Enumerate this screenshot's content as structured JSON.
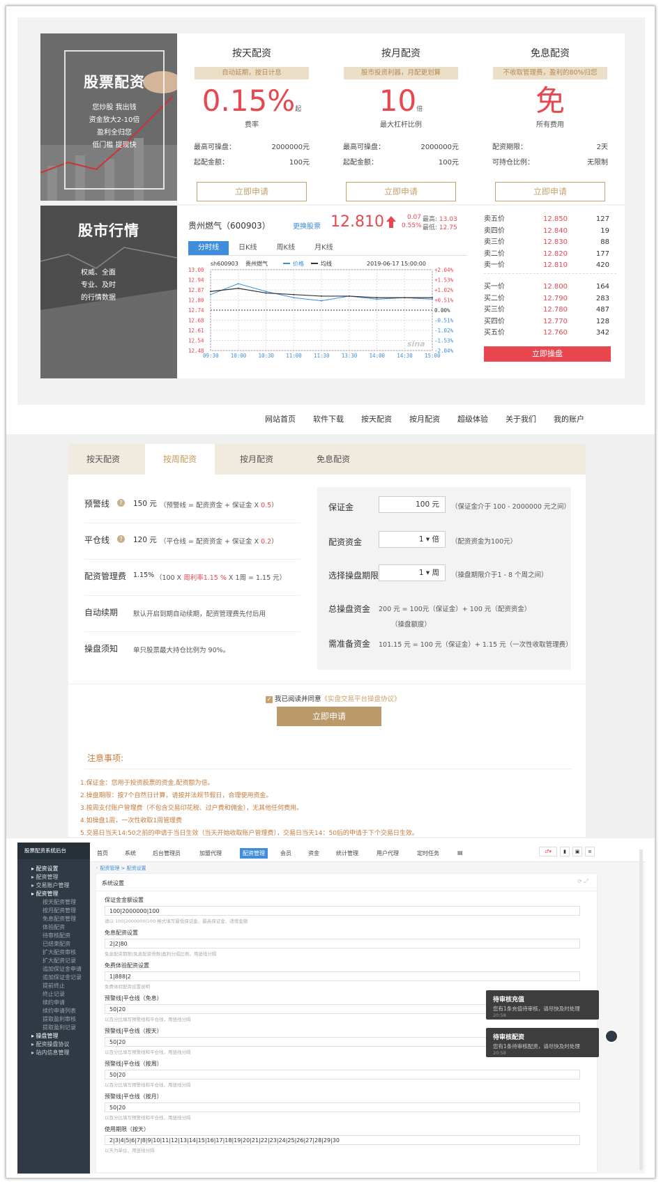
{
  "promo1": {
    "title": "股票配资",
    "lines": [
      "您炒股 我出钱",
      "资金放大2-10倍",
      "盈利全归您",
      "低门槛 提现快"
    ]
  },
  "promo2": {
    "title": "股市行情",
    "lines": [
      "权威、全面",
      "专业、及时",
      "的行情数据"
    ]
  },
  "cards": [
    {
      "title": "按天配资",
      "tag": "自动延期，按日计息",
      "big": "0.15%",
      "unit": "起",
      "sub": "费率",
      "rows": [
        [
          "最高可操盘：",
          "2000000元"
        ],
        [
          "起配金额：",
          "100元"
        ]
      ],
      "button": "立即申请"
    },
    {
      "title": "按月配资",
      "tag": "股市投资利器，月配更划算",
      "big": "10",
      "unit": "倍",
      "sub": "最大杠杆比例",
      "rows": [
        [
          "最高可操盘：",
          "2000000元"
        ],
        [
          "起配金额：",
          "100元"
        ]
      ],
      "button": "立即申请"
    },
    {
      "title": "免息配资",
      "tag": "不收取管理费，盈利的80%归您",
      "big": "免",
      "unit": "",
      "sub": "所有费用",
      "rows": [
        [
          "配资期限：",
          "2天"
        ],
        [
          "可持仓比例：",
          "无限制"
        ]
      ],
      "button": "立即申请"
    }
  ],
  "quote": {
    "name": "贵州燃气（600903）",
    "change_stock": "更换股票",
    "price": "12.810",
    "diff": "0.07",
    "pct": "0.55%",
    "high_label": "最高:",
    "high": "13.03",
    "low_label": "最低:",
    "low": "12.75",
    "tabs": [
      "分时线",
      "日K线",
      "周K线",
      "月K线"
    ],
    "chart_header": [
      "sh600903",
      "贵州燃气",
      "价格",
      "均线",
      "2019-06-17 15:00:00"
    ],
    "chart_title": "贵州燃气 分时线",
    "y_left": [
      "13.00",
      "12.94",
      "12.87",
      "12.80",
      "12.74",
      "12.68",
      "12.61",
      "12.54",
      "12.48"
    ],
    "y_right": [
      "+2.04%",
      "+1.53%",
      "+1.02%",
      "+0.51%",
      "0.00%",
      "-0.51%",
      "-1.02%",
      "-1.53%",
      "-2.04%"
    ],
    "x": [
      "09:30",
      "10:00",
      "10:30",
      "11:00",
      "11:30",
      "13:30",
      "14:00",
      "14:30",
      "15:00"
    ],
    "watermark": "sina",
    "sell": [
      [
        "卖五价",
        "12.850",
        "127"
      ],
      [
        "卖四价",
        "12.840",
        "19"
      ],
      [
        "卖三价",
        "12.830",
        "88"
      ],
      [
        "卖二价",
        "12.820",
        "177"
      ],
      [
        "卖一价",
        "12.810",
        "420"
      ]
    ],
    "buy": [
      [
        "买一价",
        "12.800",
        "164"
      ],
      [
        "买二价",
        "12.790",
        "283"
      ],
      [
        "买三价",
        "12.780",
        "487"
      ],
      [
        "买四价",
        "12.770",
        "128"
      ],
      [
        "买五价",
        "12.760",
        "342"
      ]
    ],
    "trade_button": "立即操盘",
    "colors": {
      "up": "#e8474f",
      "price_line": "#3f8ddb",
      "avg_line": "#333333",
      "tab_active": "#3f8ddb"
    }
  },
  "chart_data": {
    "type": "line",
    "x": [
      "09:30",
      "10:00",
      "10:30",
      "11:00",
      "11:30",
      "13:30",
      "14:00",
      "14:30",
      "15:00"
    ],
    "ylim": [
      12.48,
      13.0
    ],
    "series": [
      {
        "name": "价格",
        "values": [
          12.84,
          12.91,
          12.86,
          12.82,
          12.8,
          12.83,
          12.81,
          12.82,
          12.81
        ]
      },
      {
        "name": "均线",
        "values": [
          12.86,
          12.88,
          12.85,
          12.84,
          12.83,
          12.83,
          12.82,
          12.82,
          12.82
        ]
      }
    ]
  },
  "nav": [
    "网站首页",
    "软件下载",
    "按天配资",
    "按月配资",
    "超级体验",
    "关于我们",
    "我的账户"
  ],
  "form": {
    "tabs": [
      "按天配资",
      "按周配资",
      "按月配资",
      "免息配资"
    ],
    "left": [
      {
        "label": "预警线",
        "icon": "?",
        "value": "150 元",
        "note": "（预警线 = 配资资金 + 保证金 X ",
        "hl": "0.5",
        "end": "）"
      },
      {
        "label": "平仓线",
        "icon": "?",
        "value": "120 元",
        "note": "（平仓线 = 配资资金 + 保证金 X ",
        "hl": "0.2",
        "end": "）"
      },
      {
        "label": "配资管理费",
        "icon": "",
        "value": "1.15%",
        "note": "（100 X ",
        "hl": "周利率1.15 %",
        "end": " X 1周 = 1.15 元）"
      },
      {
        "label": "自动续期",
        "icon": "",
        "value": "",
        "note": "默认开启到期自动续期，配资管理费先付后用",
        "hl": "",
        "end": ""
      },
      {
        "label": "操盘须知",
        "icon": "",
        "value": "",
        "note": "单只股票最大持仓比例为 90%。",
        "hl": "",
        "end": ""
      }
    ],
    "right": [
      {
        "label": "保证金",
        "input": "100 元",
        "note": "（保证金介于 100 - 2000000 元之间）"
      },
      {
        "label": "配资资金",
        "input": "1 ▾ 倍",
        "note": "（配资资金为100元）"
      },
      {
        "label": "选择操盘期限",
        "input": "1 ▾ 周",
        "note": "（操盘期限介于1 - 8 个周之间）"
      },
      {
        "label": "总操盘资金",
        "input": "",
        "note": "200 元 = 100元（保证金）+ 100 元（配资资金）",
        "note2": "（操盘额度）"
      },
      {
        "label": "需准备资金",
        "input": "",
        "note": "101.15 元 = 100 元（保证金）+ 1.15 元（一次性收取管理费）"
      }
    ],
    "agree": "我已阅读并同意",
    "agree_link": "《实盘交易平台操盘协议》",
    "submit": "立即申请",
    "notes_title": "注意事项:",
    "notes": [
      "1.保证金：您用于投资股票的资金,配资额为倍。",
      "2.操盘期限：按7个自然日计算，请按并法规节假日，合理使用资金。",
      "3.按周支付账户管理费（不包含交易印花税、过户费和佣金），无其他任何费用。",
      "4.如操盘1周，一次性收取1周管理费",
      "5.交易日当天14:50之前的申请于当日生效（当天开始收取账户管理费），交易日当天14：50后的申请于下个交易日生效。"
    ]
  },
  "admin": {
    "brand": "股票配资系统后台",
    "side": [
      {
        "t": "配资设置",
        "g": true
      },
      {
        "t": "配资管理",
        "g": false
      },
      {
        "t": "交易账户管理",
        "g": false
      },
      {
        "t": "配资管理",
        "g": true
      },
      {
        "t": "按天配资管理",
        "s": true
      },
      {
        "t": "按月配资管理",
        "s": true
      },
      {
        "t": "免息配资管理",
        "s": true
      },
      {
        "t": "体验配资",
        "s": true
      },
      {
        "t": "待审核配资",
        "s": true
      },
      {
        "t": "已结束配资",
        "s": true
      },
      {
        "t": "扩大配资审核",
        "s": true
      },
      {
        "t": "扩大配资记录",
        "s": true
      },
      {
        "t": "追加保证金申请",
        "s": true
      },
      {
        "t": "追加保证金记录",
        "s": true
      },
      {
        "t": "提前终止",
        "s": true
      },
      {
        "t": "终止记录",
        "s": true
      },
      {
        "t": "续约申请",
        "s": true
      },
      {
        "t": "续约申请列表",
        "s": true
      },
      {
        "t": "提取盈利审核",
        "s": true
      },
      {
        "t": "提取盈利记录",
        "s": true
      },
      {
        "t": "操盘管理",
        "g": true
      },
      {
        "t": "配资操盘协议",
        "g": false
      },
      {
        "t": "站内信息管理",
        "g": false
      }
    ],
    "top": [
      "首页",
      "系统",
      "后台管理员",
      "加盟代理",
      "配资管理",
      "会员",
      "资金",
      "统计管理",
      "用户代理",
      "定时任务",
      "▤"
    ],
    "active_top": "配资管理",
    "breadcrumb": "配资管理 > 配资设置",
    "panel": "系统设置",
    "fields": [
      {
        "label": "保证金金额设置",
        "value": "100|2000000|100",
        "help": "请以 100|2000000|100 格式填写最低保证金、最高保证金、递增金额"
      },
      {
        "label": "免息配资设置",
        "value": "2|2|80",
        "help": "免息配资期限|免息配资倍数|盈利分成比例，用竖线分隔"
      },
      {
        "label": "免费体验配资设置",
        "value": "1|888|2",
        "help": "免费体验配资设置说明"
      },
      {
        "label": "预警线|平仓线（免息）",
        "value": "50|20",
        "help": "以百分比填写预警线和平仓线，用竖线分隔"
      },
      {
        "label": "预警线|平仓线（按天）",
        "value": "50|20",
        "help": "以百分比填写预警线和平仓线，用竖线分隔"
      },
      {
        "label": "预警线|平仓线（按周）",
        "value": "50|20",
        "help": "以百分比填写预警线和平仓线，用竖线分隔"
      },
      {
        "label": "预警线|平仓线（按月）",
        "value": "50|20",
        "help": "以百分比填写预警线和平仓线，用竖线分隔"
      },
      {
        "label": "使用期限（按天）",
        "value": "2|3|4|5|6|7|8|9|10|11|12|13|14|15|16|17|18|19|20|21|22|23|24|25|26|27|28|29|30",
        "help": "以天为单位，用竖线分隔"
      }
    ],
    "toasts": [
      {
        "title": "待审核充值",
        "text": "您有1条充值待审核，请尽快及时处理",
        "time": "20:58"
      },
      {
        "title": "待审核配资",
        "text": "您有1条待审核配资，请尽快及时处理",
        "time": "20:58"
      }
    ]
  }
}
